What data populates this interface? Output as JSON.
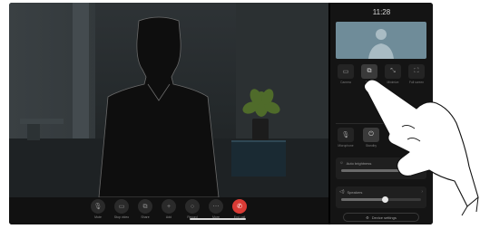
{
  "panel": {
    "time": "11:28",
    "quick_actions": [
      {
        "icon": "camera-icon",
        "glyph": "▭",
        "label": "Camera"
      },
      {
        "icon": "share-screen-icon",
        "glyph": "⧉",
        "label": "Share"
      },
      {
        "icon": "minimize-icon",
        "glyph": "⤡",
        "label": "Minimize"
      },
      {
        "icon": "full-screen-icon",
        "glyph": "⛶",
        "label": "Full screen"
      }
    ],
    "mic_buttons": [
      {
        "icon": "microphone-icon",
        "glyph": "🎙",
        "label": "Microphone"
      },
      {
        "icon": "standby-icon",
        "glyph": "⏻",
        "label": "Standby"
      }
    ],
    "brightness": {
      "label": "Auto brightness",
      "level": 0.85
    },
    "speaker": {
      "label": "Speakers",
      "level": 0.55
    },
    "settings_label": "Device settings"
  },
  "call_controls": [
    {
      "icon": "mute-icon",
      "glyph": "🎙",
      "label": "Mute"
    },
    {
      "icon": "stop-video-icon",
      "glyph": "▭",
      "label": "Stop video"
    },
    {
      "icon": "share-icon",
      "glyph": "⧉",
      "label": "Share"
    },
    {
      "icon": "add-icon",
      "glyph": "+",
      "label": "Add"
    },
    {
      "icon": "record-icon",
      "glyph": "○",
      "label": "Record"
    },
    {
      "icon": "more-icon",
      "glyph": "⋯",
      "label": "More"
    },
    {
      "icon": "end-call-icon",
      "glyph": "✆",
      "label": "End call"
    }
  ],
  "colors": {
    "end_call": "#d93b35",
    "panel_bg": "#141414",
    "selfview_bg": "#6f8c99"
  }
}
